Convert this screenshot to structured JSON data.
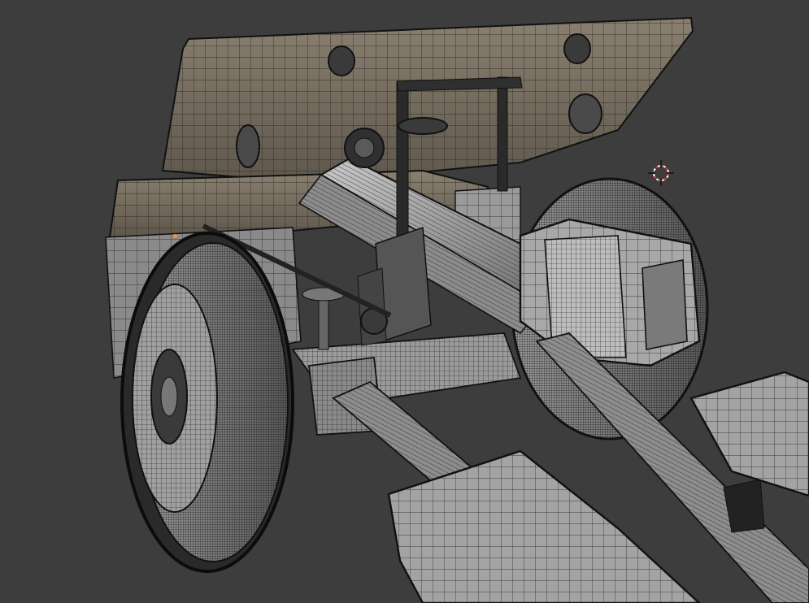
{
  "viewport": {
    "background_color": "#3d3d3d",
    "wire_color": "#111111",
    "face_color_light": "#b4b4b4",
    "face_color_dark": "#5a5a5a",
    "shield_color": "#7a7062"
  },
  "cursor": {
    "icon": "3d-cursor-icon",
    "ring_color": "#e03030",
    "cross_color": "#111111"
  },
  "origin": {
    "icon": "object-origin-icon",
    "color": "#ff8c2a"
  }
}
